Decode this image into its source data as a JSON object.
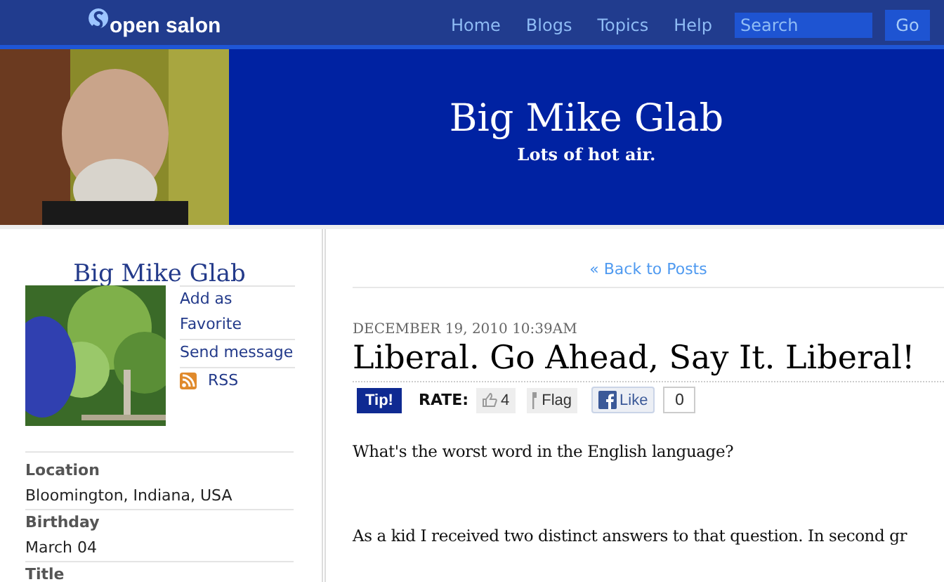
{
  "header": {
    "logo": "open salon",
    "nav": [
      "Home",
      "Blogs",
      "Topics",
      "Help"
    ],
    "search": {
      "placeholder": "Search"
    },
    "go": "Go"
  },
  "banner": {
    "title": "Big Mike Glab",
    "tagline": "Lots of hot air."
  },
  "sidebar": {
    "name": "Big Mike Glab",
    "links": [
      {
        "kind": "text",
        "label": "Add as Favorite"
      },
      {
        "kind": "text",
        "label": "Send message"
      },
      {
        "kind": "rss",
        "label": "RSS"
      }
    ],
    "fields": [
      {
        "label": "Location",
        "value": "Bloomington, Indiana, USA"
      },
      {
        "label": "Birthday",
        "value": "March 04"
      },
      {
        "label": "Title"
      }
    ]
  },
  "post": {
    "back": "« Back to Posts",
    "date": "DECEMBER 19, 2010 10:39AM",
    "title": "Liberal. Go Ahead, Say It. Liberal!",
    "tip": "Tip!",
    "rate_label": "RATE:",
    "rating": "4",
    "flag": "Flag",
    "like": "Like",
    "like_count": "0",
    "paragraphs": [
      "What's the worst word in the English language?",
      "As a kid I received two distinct answers to that question. In second gr"
    ]
  }
}
